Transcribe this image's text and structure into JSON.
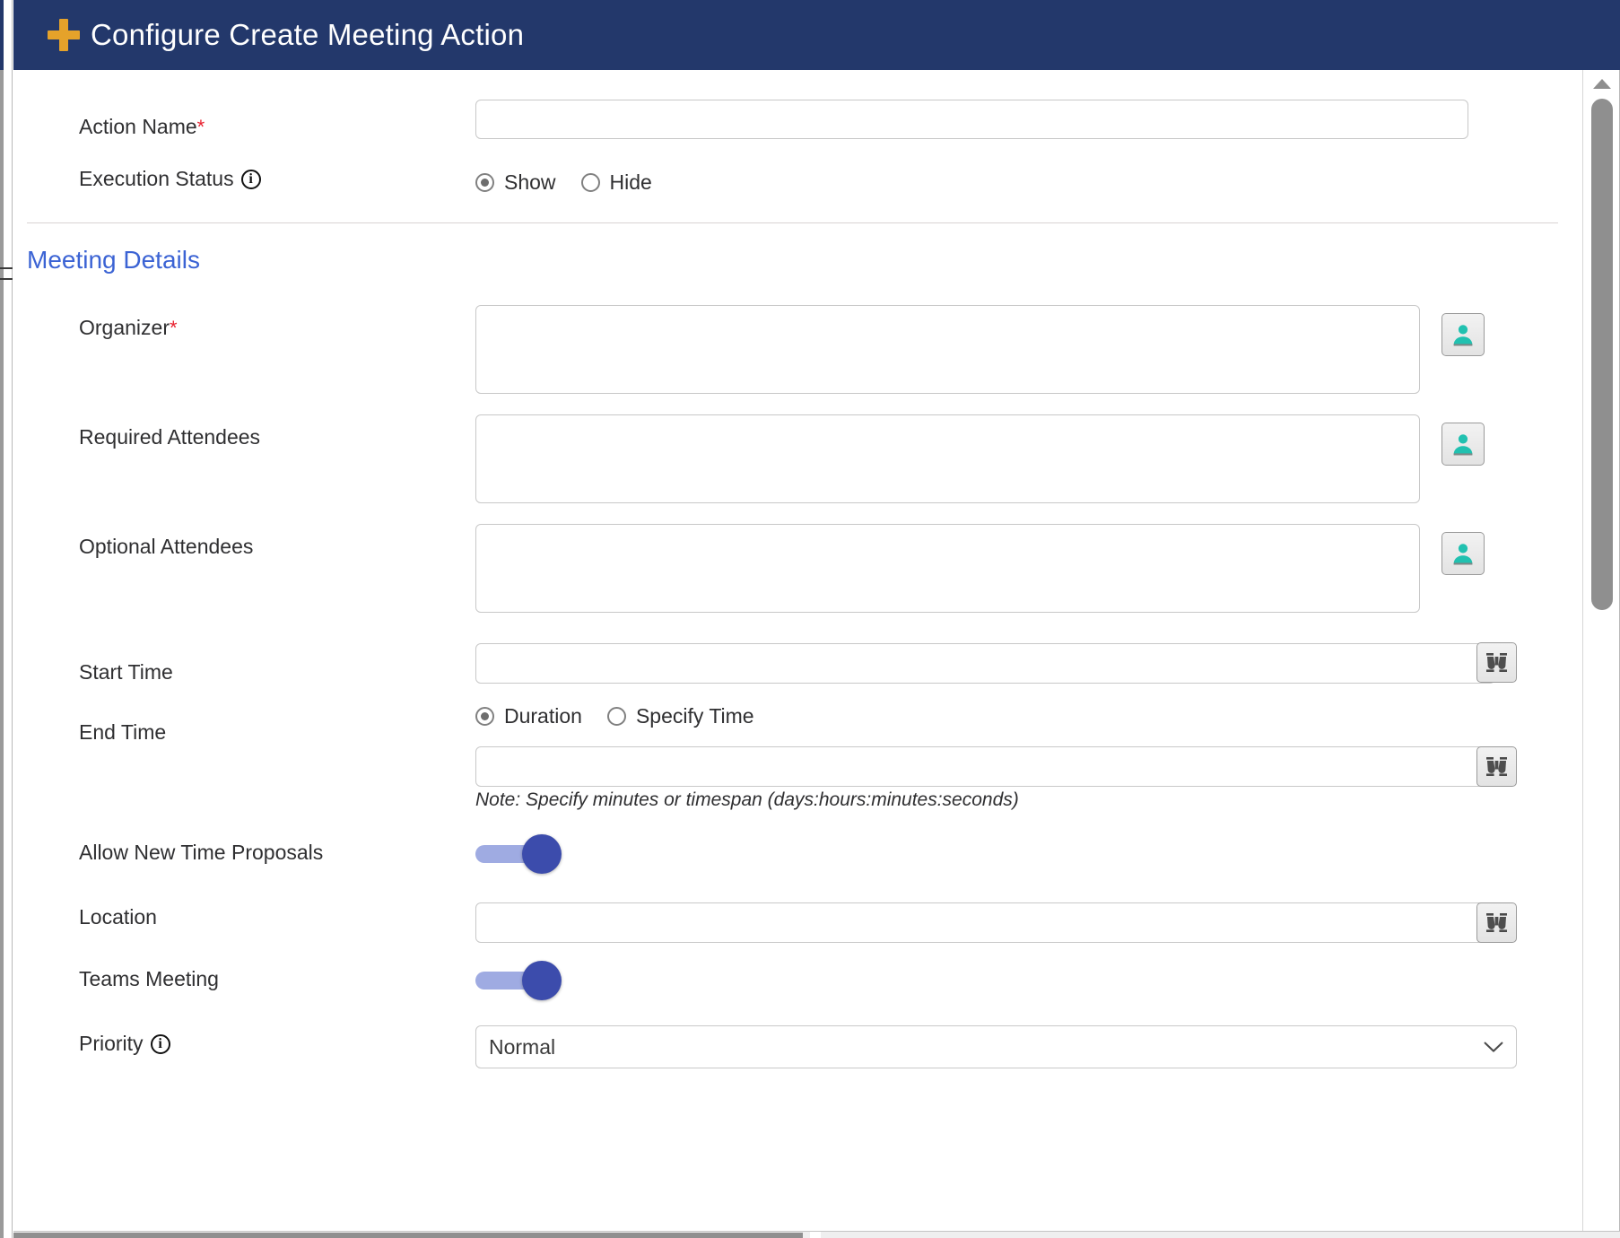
{
  "window": {
    "title": "Configure Create Meeting Action",
    "title_icon": "plus-icon",
    "header_bg": "#23386b",
    "header_icon_color": "#e5a22a"
  },
  "general": {
    "action_name": {
      "label": "Action Name",
      "required_marker": "*",
      "value": "",
      "placeholder": ""
    },
    "execution_status": {
      "label": "Execution Status",
      "info_icon": "info-icon",
      "options": [
        {
          "label": "Show",
          "selected": true
        },
        {
          "label": "Hide",
          "selected": false
        }
      ]
    }
  },
  "meeting_details": {
    "section_title": "Meeting Details",
    "section_title_color": "#3b63d4",
    "organizer": {
      "label": "Organizer",
      "required_marker": "*",
      "value": "",
      "picker_icon": "person-icon"
    },
    "required_attendees": {
      "label": "Required Attendees",
      "value": "",
      "picker_icon": "person-icon"
    },
    "optional_attendees": {
      "label": "Optional Attendees",
      "value": "",
      "picker_icon": "person-icon"
    },
    "start_time": {
      "label": "Start Time",
      "value": "",
      "picker_icon": "binoculars-icon"
    },
    "end_time": {
      "label": "End Time",
      "options": [
        {
          "label": "Duration",
          "selected": true
        },
        {
          "label": "Specify Time",
          "selected": false
        }
      ],
      "value": "",
      "picker_icon": "binoculars-icon",
      "note": "Note: Specify minutes or timespan (days:hours:minutes:seconds)"
    },
    "allow_new_time_proposals": {
      "label": "Allow New Time Proposals",
      "state": "on"
    },
    "location": {
      "label": "Location",
      "value": "",
      "picker_icon": "binoculars-icon"
    },
    "teams_meeting": {
      "label": "Teams Meeting",
      "state": "on"
    },
    "priority": {
      "label": "Priority",
      "info_icon": "info-icon",
      "value": "Normal"
    }
  },
  "colors": {
    "accent_toggle_thumb": "#3c4cac",
    "accent_toggle_track": "#9fabe2",
    "person_icon": "#21c1b0",
    "required_star": "#e8212f"
  }
}
